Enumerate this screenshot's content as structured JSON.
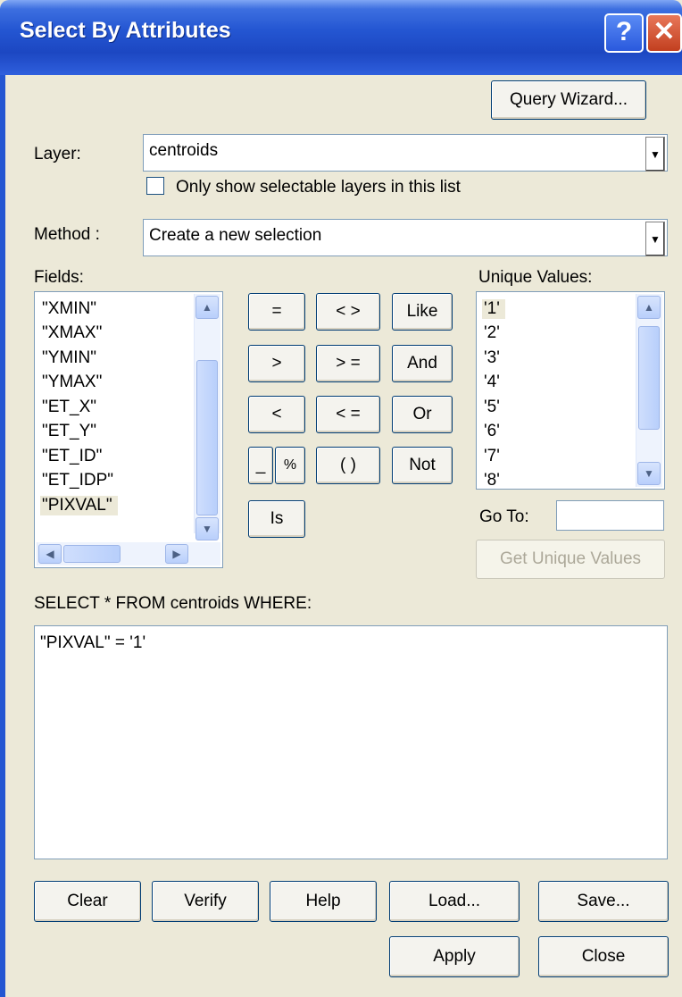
{
  "window": {
    "title": "Select By Attributes",
    "help_glyph": "?",
    "close_glyph": "✕"
  },
  "toolbar": {
    "query_wizard_label": "Query Wizard..."
  },
  "layer": {
    "label": "Layer:",
    "value": "centroids",
    "checkbox_label": "Only show selectable layers in this list",
    "checkbox_checked": false
  },
  "method": {
    "label": "Method :",
    "value": "Create a new selection"
  },
  "fields": {
    "label": "Fields:",
    "items": [
      "\"XMIN\"",
      "\"XMAX\"",
      "\"YMIN\"",
      "\"YMAX\"",
      "\"ET_X\"",
      "\"ET_Y\"",
      "\"ET_ID\"",
      "\"ET_IDP\"",
      "\"PIXVAL\""
    ],
    "selected": "\"PIXVAL\""
  },
  "operators": {
    "eq": "=",
    "ne": "< >",
    "like": "Like",
    "gt": ">",
    "ge": "> =",
    "and": "And",
    "lt": "<",
    "le": "< =",
    "or": "Or",
    "underscore": "_",
    "percent": "%",
    "parens": "( )",
    "not": "Not",
    "is": "Is"
  },
  "unique_values": {
    "label": "Unique Values:",
    "items": [
      "'1'",
      "'2'",
      "'3'",
      "'4'",
      "'5'",
      "'6'",
      "'7'",
      "'8'"
    ],
    "selected": "'1'",
    "goto_label": "Go To:",
    "goto_value": "",
    "get_unique_label": "Get Unique Values"
  },
  "query": {
    "header": "SELECT * FROM centroids WHERE:",
    "text": "\"PIXVAL\" = '1'"
  },
  "buttons": {
    "clear": "Clear",
    "verify": "Verify",
    "help": "Help",
    "load": "Load...",
    "save": "Save...",
    "apply": "Apply",
    "close": "Close"
  },
  "colors": {
    "titlebar": "#2456d2",
    "dialog_bg": "#ece9d8",
    "button_border": "#003c74",
    "close_red": "#c23f1f"
  }
}
